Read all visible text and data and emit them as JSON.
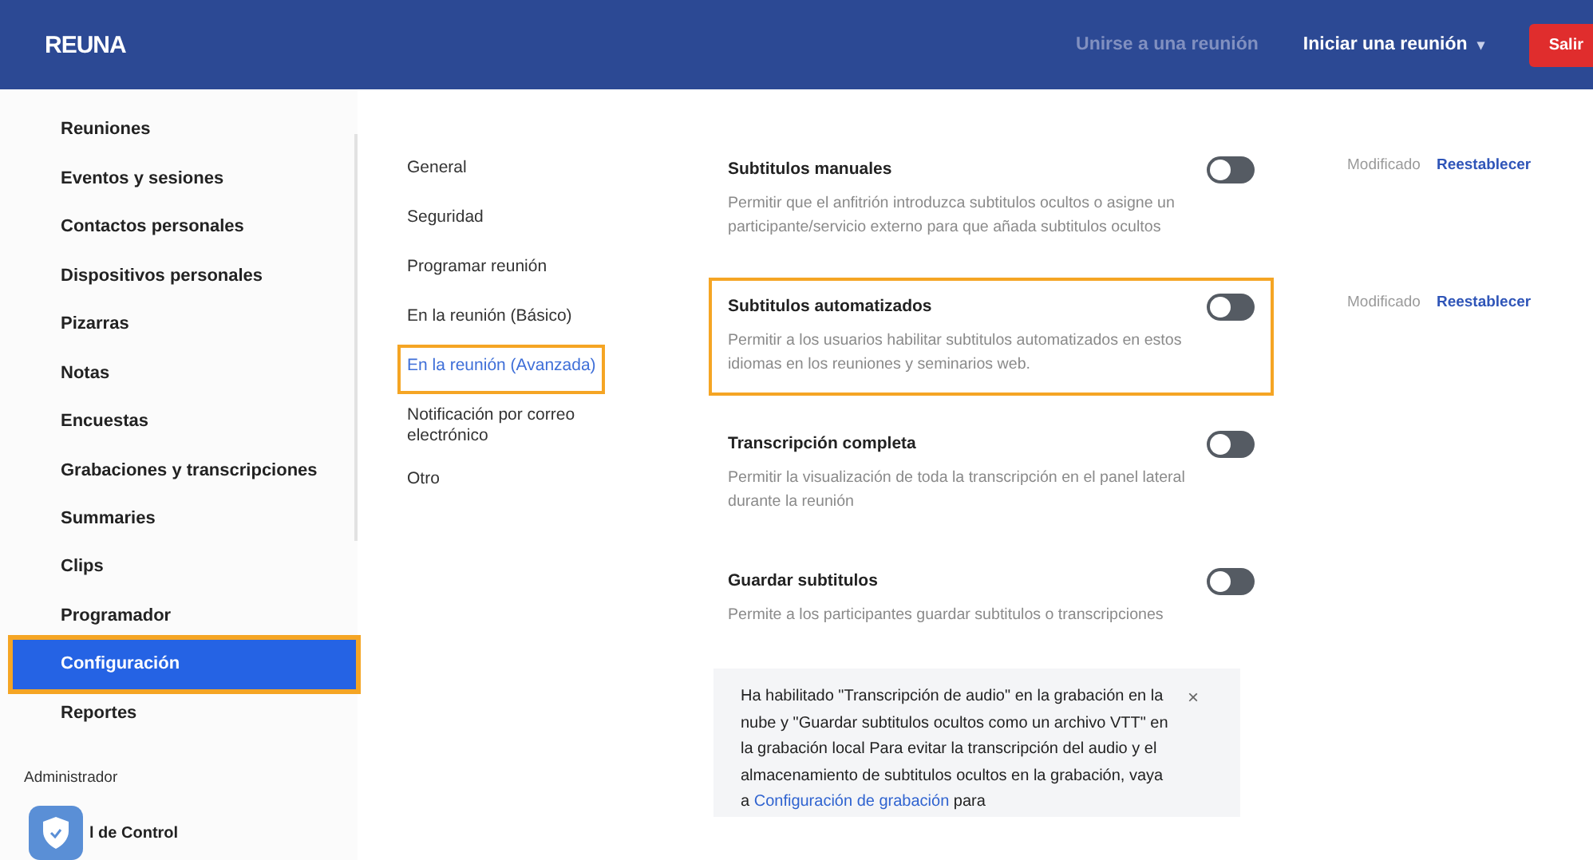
{
  "header": {
    "logo": "REUNA",
    "links": [
      {
        "label": "Unirse a una reunión",
        "kind": "muted"
      },
      {
        "label": "Iniciar una reunión",
        "kind": "menu",
        "caret": "▾"
      }
    ],
    "exit_button": "Salir"
  },
  "sidebar": {
    "items": [
      {
        "label": "Reuniones",
        "selected": false,
        "outlined": false
      },
      {
        "label": "Eventos y sesiones",
        "selected": false,
        "outlined": false
      },
      {
        "label": "Contactos personales",
        "selected": false,
        "outlined": false
      },
      {
        "label": "Dispositivos personales",
        "selected": false,
        "outlined": false
      },
      {
        "label": "Pizarras",
        "selected": false,
        "outlined": false
      },
      {
        "label": "Notas",
        "selected": false,
        "outlined": false
      },
      {
        "label": "Encuestas",
        "selected": false,
        "outlined": false
      },
      {
        "label": "Grabaciones y transcripciones",
        "selected": false,
        "outlined": false
      },
      {
        "label": "Summaries",
        "selected": false,
        "outlined": false
      },
      {
        "label": "Clips",
        "selected": false,
        "outlined": false
      },
      {
        "label": "Programador",
        "selected": false,
        "outlined": false
      },
      {
        "label": "Configuración",
        "selected": true,
        "outlined": true
      },
      {
        "label": "Reportes",
        "selected": false,
        "outlined": false
      }
    ],
    "section_label": "Administrador",
    "admin_item": "l de Control"
  },
  "subnav": {
    "items": [
      {
        "label": "General",
        "selected": false,
        "outlined": false
      },
      {
        "label": "Seguridad",
        "selected": false,
        "outlined": false
      },
      {
        "label": "Programar reunión",
        "selected": false,
        "outlined": false
      },
      {
        "label": "En la reunión (Básico)",
        "selected": false,
        "outlined": false
      },
      {
        "label": "En la reunión (Avanzada)",
        "selected": true,
        "outlined": true
      },
      {
        "label": "Notificación por correo electrónico",
        "selected": false,
        "outlined": false
      },
      {
        "label": "Otro",
        "selected": false,
        "outlined": false
      }
    ]
  },
  "settings": [
    {
      "title": "Subtitulos manuales",
      "description": "Permitir que el anfitrión introduzca subtitulos ocultos o asigne un participante/servicio externo para que añada subtitulos ocultos",
      "on": false,
      "outlined": false,
      "modified": "Modificado",
      "reset": "Reestablecer"
    },
    {
      "title": "Subtitulos automatizados",
      "description": "Permitir a los usuarios habilitar subtitulos automatizados en estos idiomas en los reuniones y seminarios web.",
      "on": false,
      "outlined": true,
      "modified": "Modificado",
      "reset": "Reestablecer"
    },
    {
      "title": "Transcripción completa",
      "description": "Permitir la visualización de toda la transcripción en el panel lateral durante la reunión",
      "on": false,
      "outlined": false
    },
    {
      "title": "Guardar subtitulos",
      "description": "Permite a los participantes guardar subtitulos o transcripciones",
      "on": false,
      "outlined": false
    }
  ],
  "notice": {
    "text_before": "Ha habilitado \"Transcripción de audio\" en la grabación en la nube y \"Guardar subtitulos ocultos como un archivo VTT\" en la grabación local Para evitar la transcripción del audio y el almacenamiento de subtitulos ocultos en la grabación, vaya a",
    "link": "Configuración de grabación",
    "text_after": "para",
    "close": "×"
  }
}
